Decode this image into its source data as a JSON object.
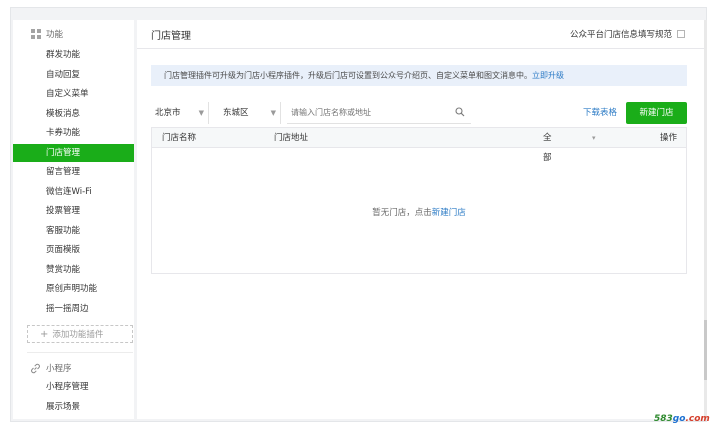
{
  "sidebar": {
    "group_function": "功能",
    "function_items": [
      {
        "label": "群发功能",
        "active": false
      },
      {
        "label": "自动回复",
        "active": false
      },
      {
        "label": "自定义菜单",
        "active": false
      },
      {
        "label": "模板消息",
        "active": false
      },
      {
        "label": "卡券功能",
        "active": false
      },
      {
        "label": "门店管理",
        "active": true
      },
      {
        "label": "留言管理",
        "active": false
      },
      {
        "label": "微信连Wi-Fi",
        "active": false
      },
      {
        "label": "投票管理",
        "active": false
      },
      {
        "label": "客服功能",
        "active": false
      },
      {
        "label": "页面模版",
        "active": false
      },
      {
        "label": "赞赏功能",
        "active": false
      },
      {
        "label": "原创声明功能",
        "active": false
      },
      {
        "label": "摇一摇周边",
        "active": false
      }
    ],
    "add_plugin_label": "添加功能插件",
    "group_miniprogram": "小程序",
    "miniprogram_items": [
      {
        "label": "小程序管理"
      },
      {
        "label": "展示场景"
      }
    ]
  },
  "main": {
    "page_title": "门店管理",
    "spec_label": "公众平台门店信息填写规范",
    "notice_text": "门店管理插件可升级为门店小程序插件，升级后门店可设置到公众号介绍页、自定义菜单和图文消息中。",
    "notice_link": "立即升级",
    "filter": {
      "city": "北京市",
      "district": "东城区",
      "search_placeholder": "请输入门店名称或地址"
    },
    "download_label": "下载表格",
    "new_store_label": "新建门店",
    "table": {
      "col_name": "门店名称",
      "col_address": "门店地址",
      "col_status": "全部",
      "col_action": "操作"
    },
    "empty_text": "暂无门店，点击",
    "empty_link": "新建门店"
  },
  "watermark": {
    "num": "583",
    "go": "go",
    "com": ".com"
  },
  "colors": {
    "accent": "#1aad19",
    "link": "#2e7cc6",
    "notice_bg": "#e9f0fa"
  }
}
